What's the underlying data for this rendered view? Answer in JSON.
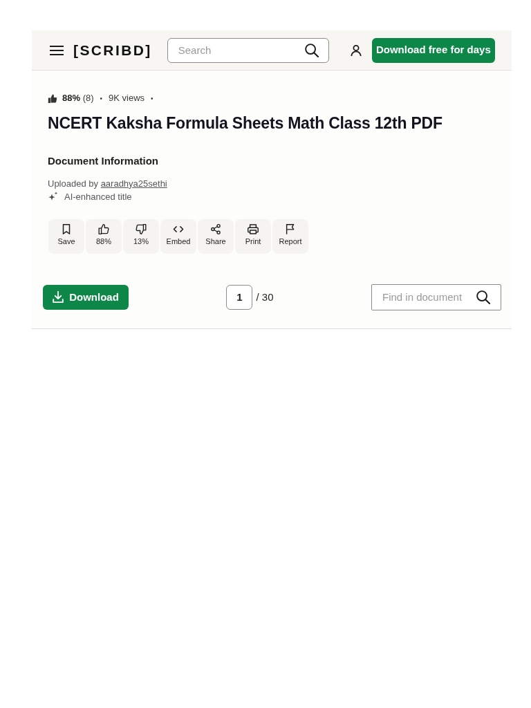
{
  "header": {
    "logo": "[SCRIBD]",
    "search": {
      "placeholder": "Search"
    },
    "download_button": "Download free for days"
  },
  "stats": [
    {
      "kind": "rating",
      "text": "**88%** (8)"
    },
    {
      "kind": "separator",
      "text": "•"
    },
    {
      "kind": "views",
      "text": "9K views"
    },
    {
      "kind": "separator",
      "text": "•"
    }
  ],
  "title": "NCERT Kaksha Formula Sheets Math Class 12th PDF",
  "info": {
    "heading": "Document Information",
    "uploaded_by": "Uploaded by",
    "uploader": "aaradhya25sethi",
    "ai_note": "AI-enhanced title"
  },
  "actions": [
    {
      "kind": "save",
      "label": "Save"
    },
    {
      "kind": "like",
      "label": "88%"
    },
    {
      "kind": "dislike",
      "label": "13%"
    },
    {
      "kind": "embed",
      "label": "Embed"
    },
    {
      "kind": "share",
      "label": "Share"
    },
    {
      "kind": "print",
      "label": "Print"
    },
    {
      "kind": "report",
      "label": "Report"
    }
  ],
  "toolbar": {
    "download_button": "Download",
    "page": {
      "value": "1",
      "total": "/ 30"
    },
    "find": {
      "placeholder": "Find in document"
    }
  }
}
